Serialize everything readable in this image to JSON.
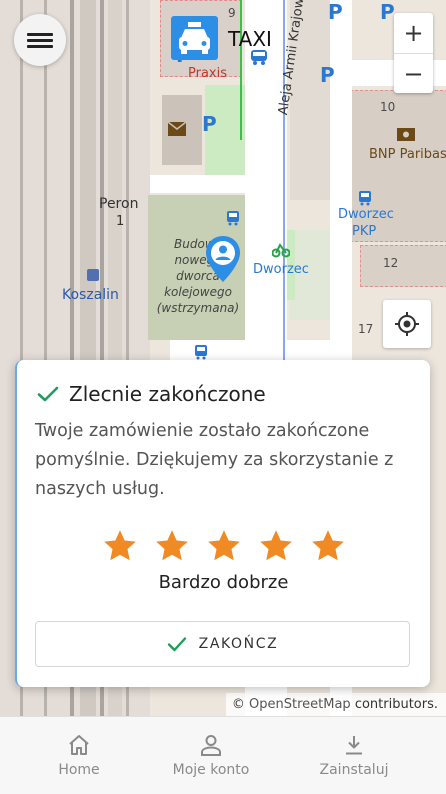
{
  "header": {
    "app_title": "TAXI"
  },
  "map": {
    "labels": {
      "praxis": "Praxis",
      "peron": "Peron",
      "peron_no": "1",
      "koszalin": "Koszalin",
      "budowa": "Budowa\nnowego\ndworca\nkolejowego\n(wstrzymana)",
      "dworzec_bus": "Dworzec",
      "dworzec_pkp_1": "Dworzec",
      "dworzec_pkp_2": "PKP",
      "aleja": "Aleja Armii Krajowej",
      "bnp": "BNP Paribas",
      "num_9": "9",
      "num_10": "10",
      "num_12": "12",
      "num_17": "17",
      "num_1": "1"
    },
    "zoom_in": "+",
    "zoom_out": "−",
    "attribution_prefix": "©",
    "attribution_link": "OpenStreetMap",
    "attribution_suffix": "contributors."
  },
  "dialog": {
    "title": "Zlecnie zakończone",
    "message": "Twoje zamówienie zostało zakończone pomyślnie. Dziękujemy za skorzystanie z naszych usług.",
    "rating": 5,
    "rating_max": 5,
    "rating_label": "Bardzo dobrze",
    "finish_label": "ZAKOŃCZ",
    "accent_color": "#1e9e5a",
    "star_color": "#f08a24"
  },
  "bottom_nav": {
    "items": [
      {
        "label": "Home",
        "icon": "home-icon"
      },
      {
        "label": "Moje konto",
        "icon": "account-icon"
      },
      {
        "label": "Zainstaluj",
        "icon": "download-icon"
      }
    ]
  }
}
